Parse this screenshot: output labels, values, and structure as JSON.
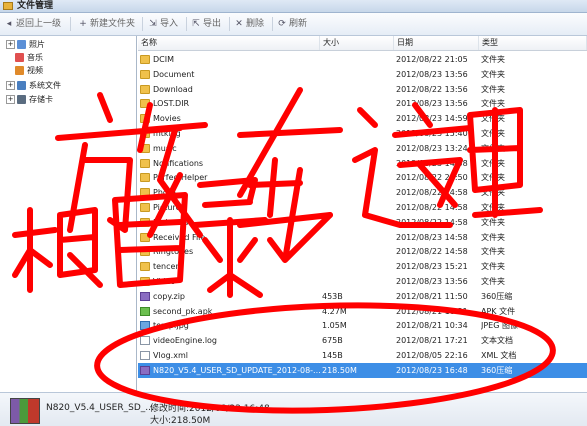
{
  "window": {
    "title": "文件管理"
  },
  "toolbar": {
    "back_label": "返回上一级",
    "new_folder_label": "新建文件夹",
    "import_label": "导入",
    "export_label": "导出",
    "delete_label": "删除",
    "refresh_label": "刷新"
  },
  "tree": {
    "items": [
      {
        "label": "照片",
        "icon": "photo-icon",
        "color": "#5b8fd6"
      },
      {
        "label": "音乐",
        "icon": "music-icon",
        "color": "#e05050"
      },
      {
        "label": "视频",
        "icon": "video-icon",
        "color": "#e08a2a"
      },
      {
        "label": "系统文件",
        "icon": "system-files-icon",
        "color": "#4a7fc0"
      },
      {
        "label": "存储卡",
        "icon": "sd-card-icon",
        "color": "#5a6c80"
      }
    ]
  },
  "columns": {
    "name": "名称",
    "size": "大小",
    "date": "日期",
    "type": "类型"
  },
  "files": [
    {
      "name": "DCIM",
      "size": "",
      "date": "2012/08/22 21:05",
      "type": "文件夹",
      "icon": "folder"
    },
    {
      "name": "Document",
      "size": "",
      "date": "2012/08/23 13:56",
      "type": "文件夹",
      "icon": "folder"
    },
    {
      "name": "Download",
      "size": "",
      "date": "2012/08/22 13:56",
      "type": "文件夹",
      "icon": "folder"
    },
    {
      "name": "LOST.DIR",
      "size": "",
      "date": "2012/08/23 13:56",
      "type": "文件夹",
      "icon": "folder"
    },
    {
      "name": "Movies",
      "size": "",
      "date": "2012/08/23 14:59",
      "type": "文件夹",
      "icon": "folder"
    },
    {
      "name": "mtklog",
      "size": "",
      "date": "2012/08/23 15:40",
      "type": "文件夹",
      "icon": "folder"
    },
    {
      "name": "music",
      "size": "",
      "date": "2012/08/23 13:24",
      "type": "文件夹",
      "icon": "folder"
    },
    {
      "name": "Notifications",
      "size": "",
      "date": "2012/08/23 14:58",
      "type": "文件夹",
      "icon": "folder"
    },
    {
      "name": "PerfectHelper",
      "size": "",
      "date": "2012/08/22 20:50",
      "type": "文件夹",
      "icon": "folder"
    },
    {
      "name": "Photo",
      "size": "",
      "date": "2012/08/22 14:58",
      "type": "文件夹",
      "icon": "folder"
    },
    {
      "name": "Pictures",
      "size": "",
      "date": "2012/08/22 14:58",
      "type": "文件夹",
      "icon": "folder"
    },
    {
      "name": "Podcasts",
      "size": "",
      "date": "2012/08/22 14:58",
      "type": "文件夹",
      "icon": "folder"
    },
    {
      "name": "Received File",
      "size": "",
      "date": "2012/08/23 14:58",
      "type": "文件夹",
      "icon": "folder"
    },
    {
      "name": "Ringtones",
      "size": "",
      "date": "2012/08/22 14:58",
      "type": "文件夹",
      "icon": "folder"
    },
    {
      "name": "tencent",
      "size": "",
      "date": "2012/08/23 15:21",
      "type": "文件夹",
      "icon": "folder"
    },
    {
      "name": "Video",
      "size": "",
      "date": "2012/08/23 13:56",
      "type": "文件夹",
      "icon": "folder"
    },
    {
      "name": "copy.zip",
      "size": "453B",
      "date": "2012/08/21 11:50",
      "type": "360压缩",
      "icon": "zip"
    },
    {
      "name": "second_pk.apk",
      "size": "4.27M",
      "date": "2012/08/21 10:31",
      "type": "APK 文件",
      "icon": "apk"
    },
    {
      "name": "temp.jpg",
      "size": "1.05M",
      "date": "2012/08/21 10:34",
      "type": "JPEG 图像",
      "icon": "img"
    },
    {
      "name": "videoEngine.log",
      "size": "675B",
      "date": "2012/08/21 17:21",
      "type": "文本文档",
      "icon": "txt"
    },
    {
      "name": "Vlog.xml",
      "size": "145B",
      "date": "2012/08/05 22:16",
      "type": "XML 文档",
      "icon": "xml"
    },
    {
      "name": "N820_V5.4_USER_SD_UPDATE_2012-08-...",
      "size": "218.50M",
      "date": "2012/08/23 16:48",
      "type": "360压缩",
      "icon": "zip",
      "selected": true
    }
  ],
  "status": {
    "file_name": "N820_V5.4_USER_SD_...",
    "modified": "修改时间:2012/08/23 16:48",
    "size": "大小:218.50M"
  },
  "annotation": {
    "text_top_1": "放",
    "text_top_2": "在这里",
    "text_bottom": "根目录",
    "color": "#ff0000"
  }
}
